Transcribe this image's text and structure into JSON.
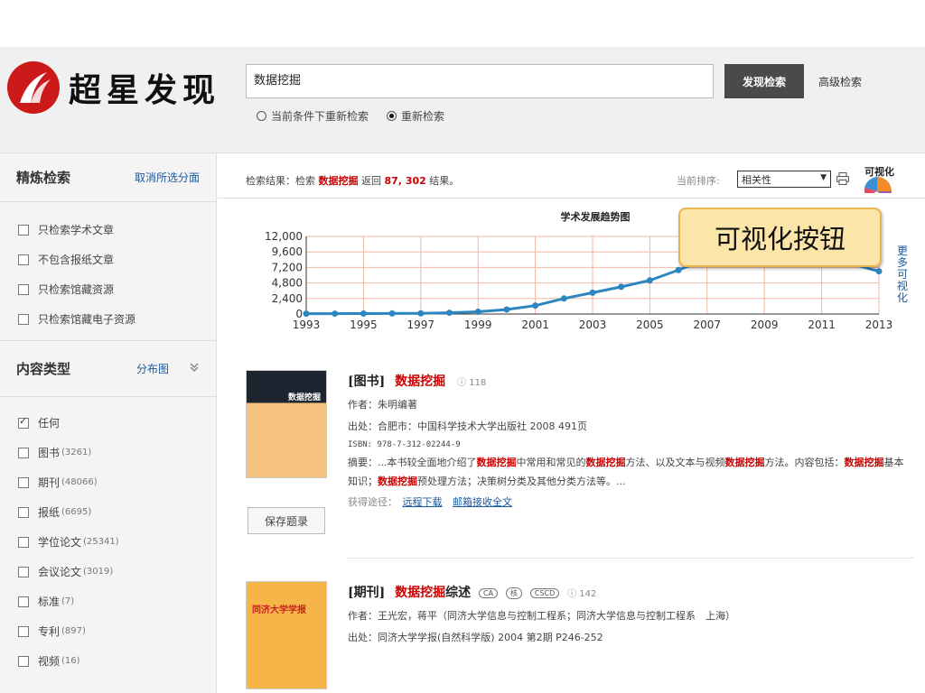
{
  "header": {
    "logo_text": "超星发现",
    "search_value": "数据挖掘",
    "search_button": "发现检索",
    "advanced_search": "高级检索",
    "radio_options": [
      {
        "label": "当前条件下重新检索",
        "selected": false
      },
      {
        "label": "重新检索",
        "selected": true
      }
    ]
  },
  "sidebar": {
    "refine": {
      "title": "精炼检索",
      "action": "取消所选分面",
      "items": [
        "只检索学术文章",
        "不包含报纸文章",
        "只检索馆藏资源",
        "只检索馆藏电子资源"
      ]
    },
    "content_type": {
      "title": "内容类型",
      "action": "分布图",
      "items": [
        {
          "label": "任何",
          "count": "",
          "checked": true
        },
        {
          "label": "图书",
          "count": "(3261)",
          "checked": false
        },
        {
          "label": "期刊",
          "count": "(48066)",
          "checked": false
        },
        {
          "label": "报纸",
          "count": "(6695)",
          "checked": false
        },
        {
          "label": "学位论文",
          "count": "(25341)",
          "checked": false
        },
        {
          "label": "会议论文",
          "count": "(3019)",
          "checked": false
        },
        {
          "label": "标准",
          "count": "(7)",
          "checked": false
        },
        {
          "label": "专利",
          "count": "(897)",
          "checked": false
        },
        {
          "label": "视频",
          "count": "(16)",
          "checked": false
        }
      ]
    }
  },
  "results_bar": {
    "prefix": "检索结果：检索",
    "keyword": "数据挖掘",
    "middle": "返回",
    "count": "87, 302",
    "suffix": "结果。",
    "sort_label": "当前排序:",
    "sort_value": "相关性",
    "viz_label": "可视化"
  },
  "callout": "可视化按钮",
  "more_viz": "更多可视化",
  "chart_data": {
    "type": "line",
    "title": "学术发展趋势图",
    "x": [
      1993,
      1994,
      1995,
      1996,
      1997,
      1998,
      1999,
      2000,
      2001,
      2002,
      2003,
      2004,
      2005,
      2006,
      2007,
      2008,
      2009,
      2010,
      2011,
      2012,
      2013
    ],
    "y": [
      50,
      60,
      70,
      80,
      100,
      200,
      350,
      700,
      1300,
      2400,
      3300,
      4200,
      5200,
      6800,
      8500,
      9200,
      9400,
      9300,
      8800,
      7800,
      6600
    ],
    "x_ticks": [
      "1993",
      "1995",
      "1997",
      "1999",
      "2001",
      "2003",
      "2005",
      "2007",
      "2009",
      "2011",
      "2013"
    ],
    "y_ticks": [
      "0",
      "2,400",
      "4,800",
      "7,200",
      "9,600",
      "12,000"
    ],
    "ylim": [
      0,
      12000
    ],
    "grid": true,
    "color": "#2e86c1",
    "grid_color": "#f2b8a6"
  },
  "results": [
    {
      "type_label": "[图书]",
      "title_kw": "数据挖掘",
      "title_rest": "",
      "badges": [],
      "cite": "118",
      "cover_title": "数据挖掘",
      "save_label": "保存题录",
      "author": "作者：朱明编著",
      "source": "出处：合肥市：中国科学技术大学出版社 2008 491页",
      "isbn": "ISBN: 978-7-312-02244-9",
      "abstract": [
        {
          "t": "摘要：...本书较全面地介绍了",
          "hl": false
        },
        {
          "t": "数据挖掘",
          "hl": true
        },
        {
          "t": "中常用和常见的",
          "hl": false
        },
        {
          "t": "数据挖掘",
          "hl": true
        },
        {
          "t": "方法、以及文本与视频",
          "hl": false
        },
        {
          "t": "数据挖掘",
          "hl": true
        },
        {
          "t": "方法。内容包括：",
          "hl": false
        },
        {
          "t": "数据挖掘",
          "hl": true
        },
        {
          "t": "基本知识；",
          "hl": false
        },
        {
          "t": "数据挖掘",
          "hl": true
        },
        {
          "t": "预处理方法；决策树分类及其他分类方法等。...",
          "hl": false
        }
      ],
      "access_label": "获得途径：",
      "access_links": [
        "远程下载",
        "邮箱接收全文"
      ]
    },
    {
      "type_label": "[期刊]",
      "title_kw": "数据挖掘",
      "title_rest": "综述",
      "badges": [
        "CA",
        "核",
        "CSCD"
      ],
      "cite": "142",
      "cover_title": "同济大学学报",
      "author": "作者：王光宏，蒋平（同济大学信息与控制工程系；同济大学信息与控制工程系　上海）",
      "source": "出处：同济大学学报(自然科学版) 2004 第2期 P246-252"
    }
  ]
}
